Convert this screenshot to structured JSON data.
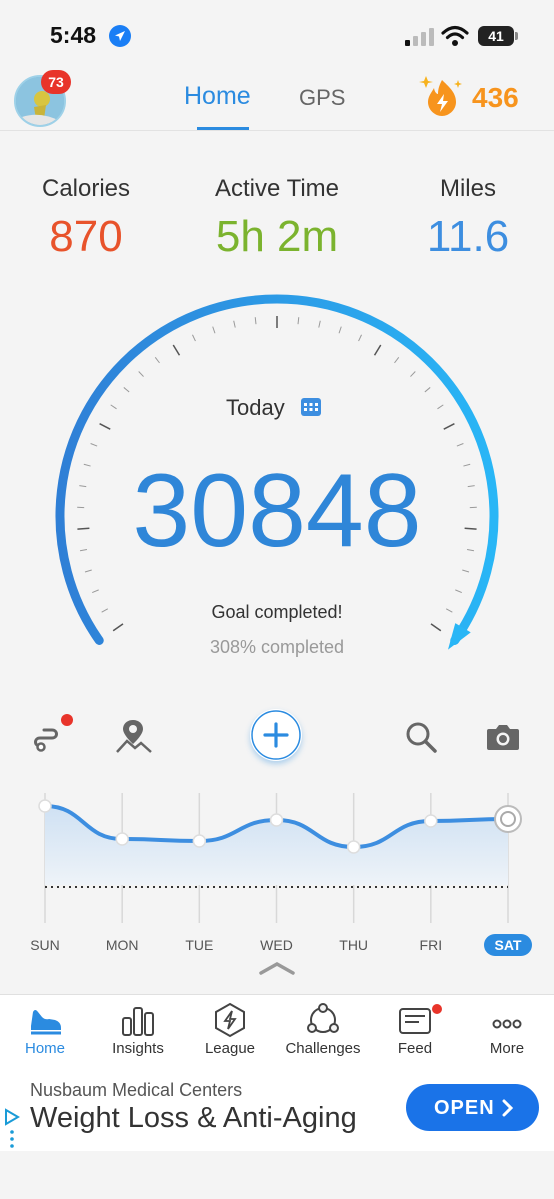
{
  "status_bar": {
    "time": "5:48",
    "battery": "41"
  },
  "header": {
    "avatar_badge": "73",
    "tabs": [
      {
        "label": "Home",
        "active": true
      },
      {
        "label": "GPS",
        "active": false
      }
    ],
    "coins": "436"
  },
  "stats": [
    {
      "label": "Calories",
      "value": "870",
      "color": "#e8532b"
    },
    {
      "label": "Active Time",
      "value": "5h 2m",
      "color": "#7bb32e"
    },
    {
      "label": "Miles",
      "value": "11.6",
      "color": "#3d8ee0"
    }
  ],
  "gauge": {
    "today_label": "Today",
    "steps": "30848",
    "goal_text": "Goal completed!",
    "percent_text": "308% completed",
    "progress_fraction": 1.0
  },
  "week": {
    "days": [
      "SUN",
      "MON",
      "TUE",
      "WED",
      "THU",
      "FRI",
      "SAT"
    ],
    "selected": "SAT"
  },
  "bottom_nav": [
    {
      "label": "Home",
      "icon": "shoe-icon",
      "active": true
    },
    {
      "label": "Insights",
      "icon": "bar-chart-icon"
    },
    {
      "label": "League",
      "icon": "hexagon-bolt-icon"
    },
    {
      "label": "Challenges",
      "icon": "people-circle-icon"
    },
    {
      "label": "Feed",
      "icon": "feed-icon",
      "has_dot": true
    },
    {
      "label": "More",
      "icon": "dots-icon"
    }
  ],
  "ad": {
    "advertiser": "Nusbaum Medical Centers",
    "headline": "Weight Loss & Anti-Aging",
    "cta": "OPEN"
  },
  "colors": {
    "accent": "#2b8be0",
    "coins": "#f7941d",
    "badge": "#e8342a"
  }
}
